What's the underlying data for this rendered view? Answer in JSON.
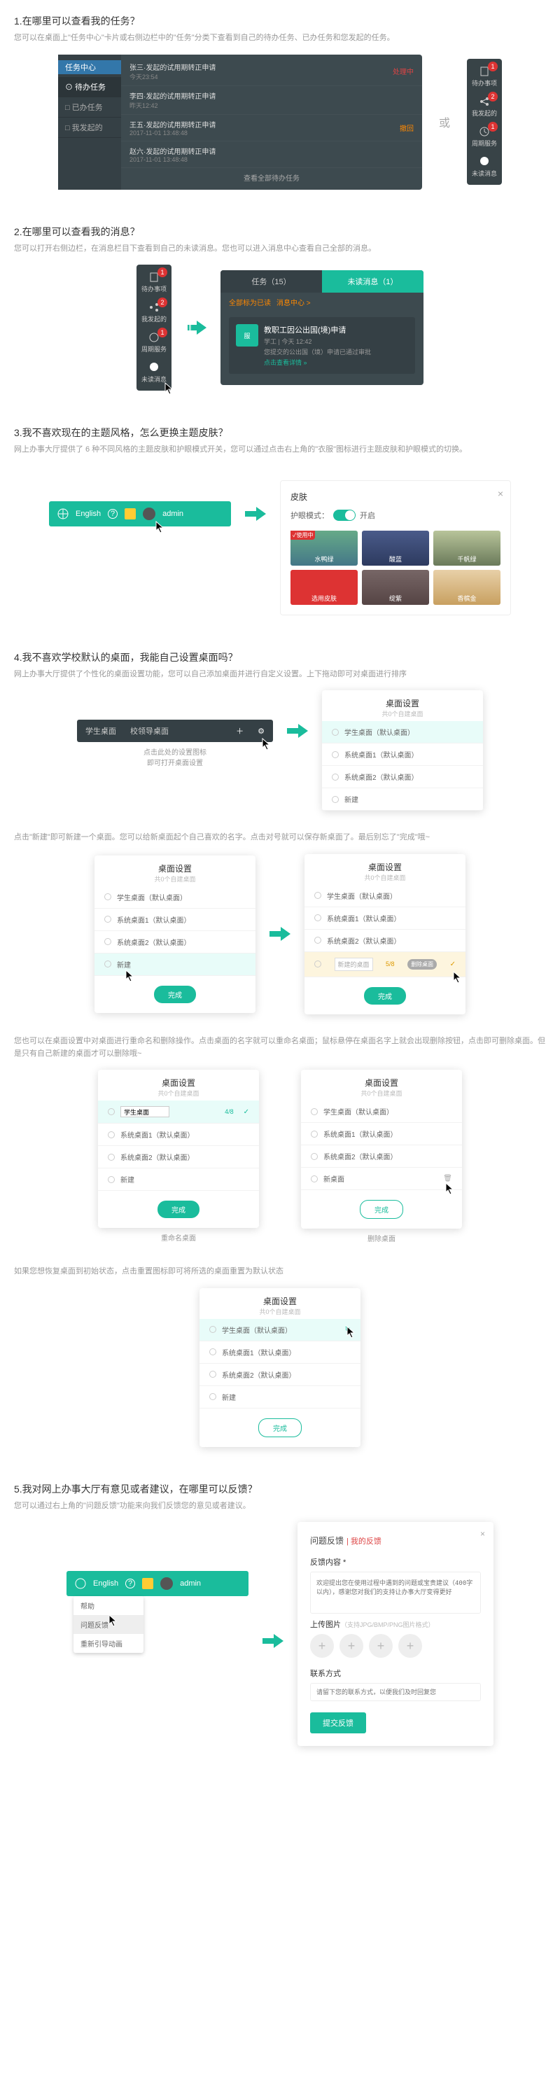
{
  "q1": {
    "title": "1.在哪里可以查看我的任务？",
    "desc": "您可以在桌面上\"任务中心\"卡片或右侧边栏中的\"任务\"分类下查看到自己的待办任务、已办任务和您发起的任务。",
    "center_title": "任务中心",
    "side": {
      "todo": "⊙ 待办任务",
      "done": "□ 已办任务",
      "mine": "□ 我发起的"
    },
    "rows": [
      {
        "t": "张三·发起的试用期转正申请",
        "s": "今天23:54",
        "a": "处理中"
      },
      {
        "t": "李四·发起的试用期转正申请",
        "s": "昨天12:42",
        "a": ""
      },
      {
        "t": "王五·发起的试用期转正申请",
        "s": "2017-11-01 13:48:48",
        "a": "撤回"
      },
      {
        "t": "赵六·发起的试用期转正申请",
        "s": "2017-11-01 13:48:48",
        "a": ""
      }
    ],
    "footer": "查看全部待办任务",
    "or": "或",
    "mini": {
      "todo": "待办事项",
      "mine": "我发起的",
      "cycle": "周期服务",
      "msg": "未读消息",
      "b1": "1",
      "b2": "2",
      "b3": "1"
    }
  },
  "q2": {
    "title": "2.在哪里可以查看我的消息？",
    "desc": "您可以打开右侧边栏，在消息栏目下查看到自己的未读消息。您也可以进入消息中心查看自己全部的消息。",
    "tabs": {
      "a": "任务（15）",
      "b": "未读消息（1）"
    },
    "sub": {
      "a": "全部标为已读",
      "b": "消息中心 >"
    },
    "card": {
      "av": "服",
      "title": "教职工因公出国(境)申请",
      "sub": "学工 | 今天 12:42",
      "note": "您提交的公出国（境）申请已通过审批",
      "link": "点击查看详情 »"
    }
  },
  "q3": {
    "title": "3.我不喜欢现在的主题风格，怎么更换主题皮肤？",
    "desc": "网上办事大厅提供了 6 种不同风格的主题皮肤和护眼模式开关，您可以通过点击右上角的\"衣服\"图标进行主题皮肤和护眼模式的切换。",
    "topbar": {
      "lang": "English",
      "q": "?",
      "user": "admin"
    },
    "skin": {
      "title": "皮肤",
      "eye": "护眼模式：",
      "eye_on": "开启",
      "cells": [
        {
          "name": "水鸭绿",
          "bg": "linear-gradient(#6a8,#478)",
          "badge": "✓使用中"
        },
        {
          "name": "酸蓝",
          "bg": "linear-gradient(#4a5b8a,#2d3a5f)"
        },
        {
          "name": "千帆绿",
          "bg": "linear-gradient(#b8c49a,#6a7a5a)"
        },
        {
          "name": "选用皮肤",
          "bg": "#d33"
        },
        {
          "name": "绽紫",
          "bg": "linear-gradient(#766,#544)"
        },
        {
          "name": "香槟金",
          "bg": "linear-gradient(#e8d0a8,#c8a060)"
        }
      ]
    }
  },
  "q4": {
    "title": "4.我不喜欢学校默认的桌面，我能自己设置桌面吗？",
    "desc1": "网上办事大厅提供了个性化的桌面设置功能，您可以自己添加桌面并进行自定义设置。上下拖动即可对桌面进行排序",
    "tabbar": {
      "a": "学生桌面",
      "b": "校领导桌面"
    },
    "caption1a": "点击此处的设置图标",
    "caption1b": "即可打开桌面设置",
    "dlg_title": "桌面设置",
    "dlg_sub": "共0个自建桌面",
    "items": {
      "r1": "学生桌面（默认桌面）",
      "r2": "系统桌面1（默认桌面）",
      "r3": "系统桌面2（默认桌面）",
      "new": "新建"
    },
    "desc2": "点击\"新建\"即可新建一个桌面。您可以给新桌面起个自己喜欢的名字。点击对号就可以保存新桌面了。最后别忘了\"完成\"哦~",
    "edit": {
      "box": "新建的桌面",
      "cnt": "5/8",
      "btn": "删除桌面"
    },
    "desc3": "您也可以在桌面设置中对桌面进行重命名和删除操作。点击桌面的名字就可以重命名桌面；鼠标悬停在桌面名字上就会出现删除按钮，点击即可删除桌面。但是只有自己新建的桌面才可以删除哦~",
    "rename": {
      "val": "学生桌面",
      "cnt": "4/8"
    },
    "newdesk": "新桌面",
    "cap_rename": "重命名桌面",
    "cap_delete": "删除桌面",
    "desc4": "如果您想恢复桌面到初始状态，点击重置图标即可将所选的桌面重置为默认状态",
    "reset_ico": "↻",
    "ok": "完成"
  },
  "q5": {
    "title": "5.我对网上办事大厅有意见或者建议，在哪里可以反馈？",
    "desc": "您可以通过右上角的\"问题反馈\"功能来向我们反馈您的意见或者建议。",
    "menu": {
      "a": "帮助",
      "b": "问题反馈",
      "c": "重新引导动画"
    },
    "fb": {
      "title": "问题反馈",
      "my": "| 我的反馈",
      "lab1": "反馈内容 *",
      "ta": "欢迎提出您在使用过程中遇到的问题或宝贵建议（400字以内），感谢您对我们的支持让办事大厅变得更好",
      "lab2": "上传图片",
      "lab2_hint": "（支持JPG/BMP/PNG图片格式）",
      "lab3": "联系方式",
      "in": "请留下您的联系方式，以便我们及时回复您",
      "btn": "提交反馈"
    }
  }
}
